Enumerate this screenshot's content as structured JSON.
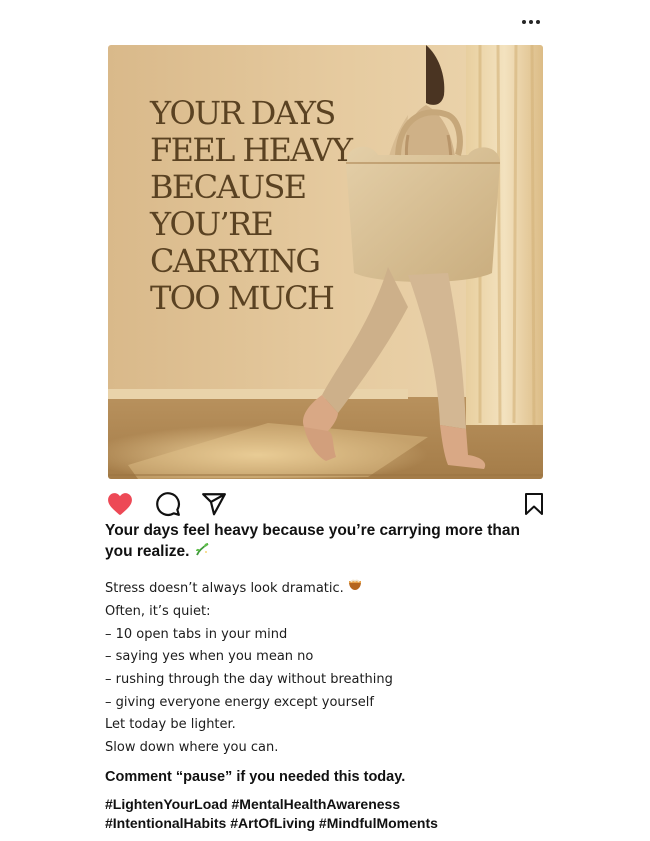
{
  "post": {
    "image": {
      "headline": "YOUR DAYS\nFEEL HEAVY\nBECAUSE\nYOU’RE\nCARRYING\nTOO MUCH",
      "description": ""
    },
    "actions": {
      "liked": true,
      "like_icon": "heart-filled-icon",
      "comment_icon": "comment-icon",
      "share_icon": "send-icon",
      "save_icon": "bookmark-icon",
      "like_color": "#ed4956"
    },
    "caption": {
      "title": "Your days feel heavy because you’re carrying more than you realize.",
      "title_emoji": "seedling-sparkle",
      "lines": [
        "Stress doesn’t always look dramatic.",
        "Often, it’s quiet:",
        "– 10 open tabs in your mind",
        "– saying yes when you mean no",
        "– rushing through the day without breathing",
        "– giving everyone energy except yourself",
        "Let today be lighter.",
        "Slow down where you can."
      ],
      "line_one_emoji": "bowl",
      "cta": "Comment “pause” if you needed this today.",
      "hashtags": [
        "#LightenYourLoad",
        "#MentalHealthAwareness",
        "#IntentionalHabits",
        "#ArtOfLiving",
        "#MindfulMoments"
      ]
    }
  }
}
